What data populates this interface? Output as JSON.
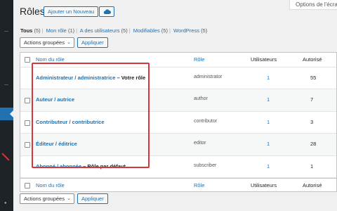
{
  "screen_options": "Options de l'écran",
  "page": {
    "title": "Rôles",
    "add_new_label": "Ajouter un Nouveau",
    "cloud_icon": "cloud-icon"
  },
  "filters": [
    {
      "label": "Tous",
      "count": "(5)",
      "current": true
    },
    {
      "label": "Mon rôle",
      "count": "(1)"
    },
    {
      "label": "A des utilisateurs",
      "count": "(5)"
    },
    {
      "label": "Modifiables",
      "count": "(5)"
    },
    {
      "label": "WordPress",
      "count": "(5)"
    }
  ],
  "bulk": {
    "select_value": "Actions groupées",
    "apply_label": "Appliquer"
  },
  "columns": {
    "name": "Nom du rôle",
    "role": "Rôle",
    "users": "Utilisateurs",
    "authorized": "Autorisé"
  },
  "rows": [
    {
      "name": "Administrateur / administratrice",
      "suffix": "– Votre rôle",
      "role": "administrator",
      "users": "1",
      "authorized": "55"
    },
    {
      "name": "Auteur / autrice",
      "suffix": "",
      "role": "author",
      "users": "1",
      "authorized": "7"
    },
    {
      "name": "Contributeur / contributrice",
      "suffix": "",
      "role": "contributor",
      "users": "1",
      "authorized": "3"
    },
    {
      "name": "Éditeur / éditrice",
      "suffix": "",
      "role": "editor",
      "users": "1",
      "authorized": "28"
    },
    {
      "name": "Abonné / abonnée",
      "suffix": "– Rôle par défaut",
      "role": "subscriber",
      "users": "1",
      "authorized": "1"
    }
  ],
  "colors": {
    "accent": "#2271b1",
    "highlight_border": "#d63638",
    "sidebar": "#1d2327"
  }
}
